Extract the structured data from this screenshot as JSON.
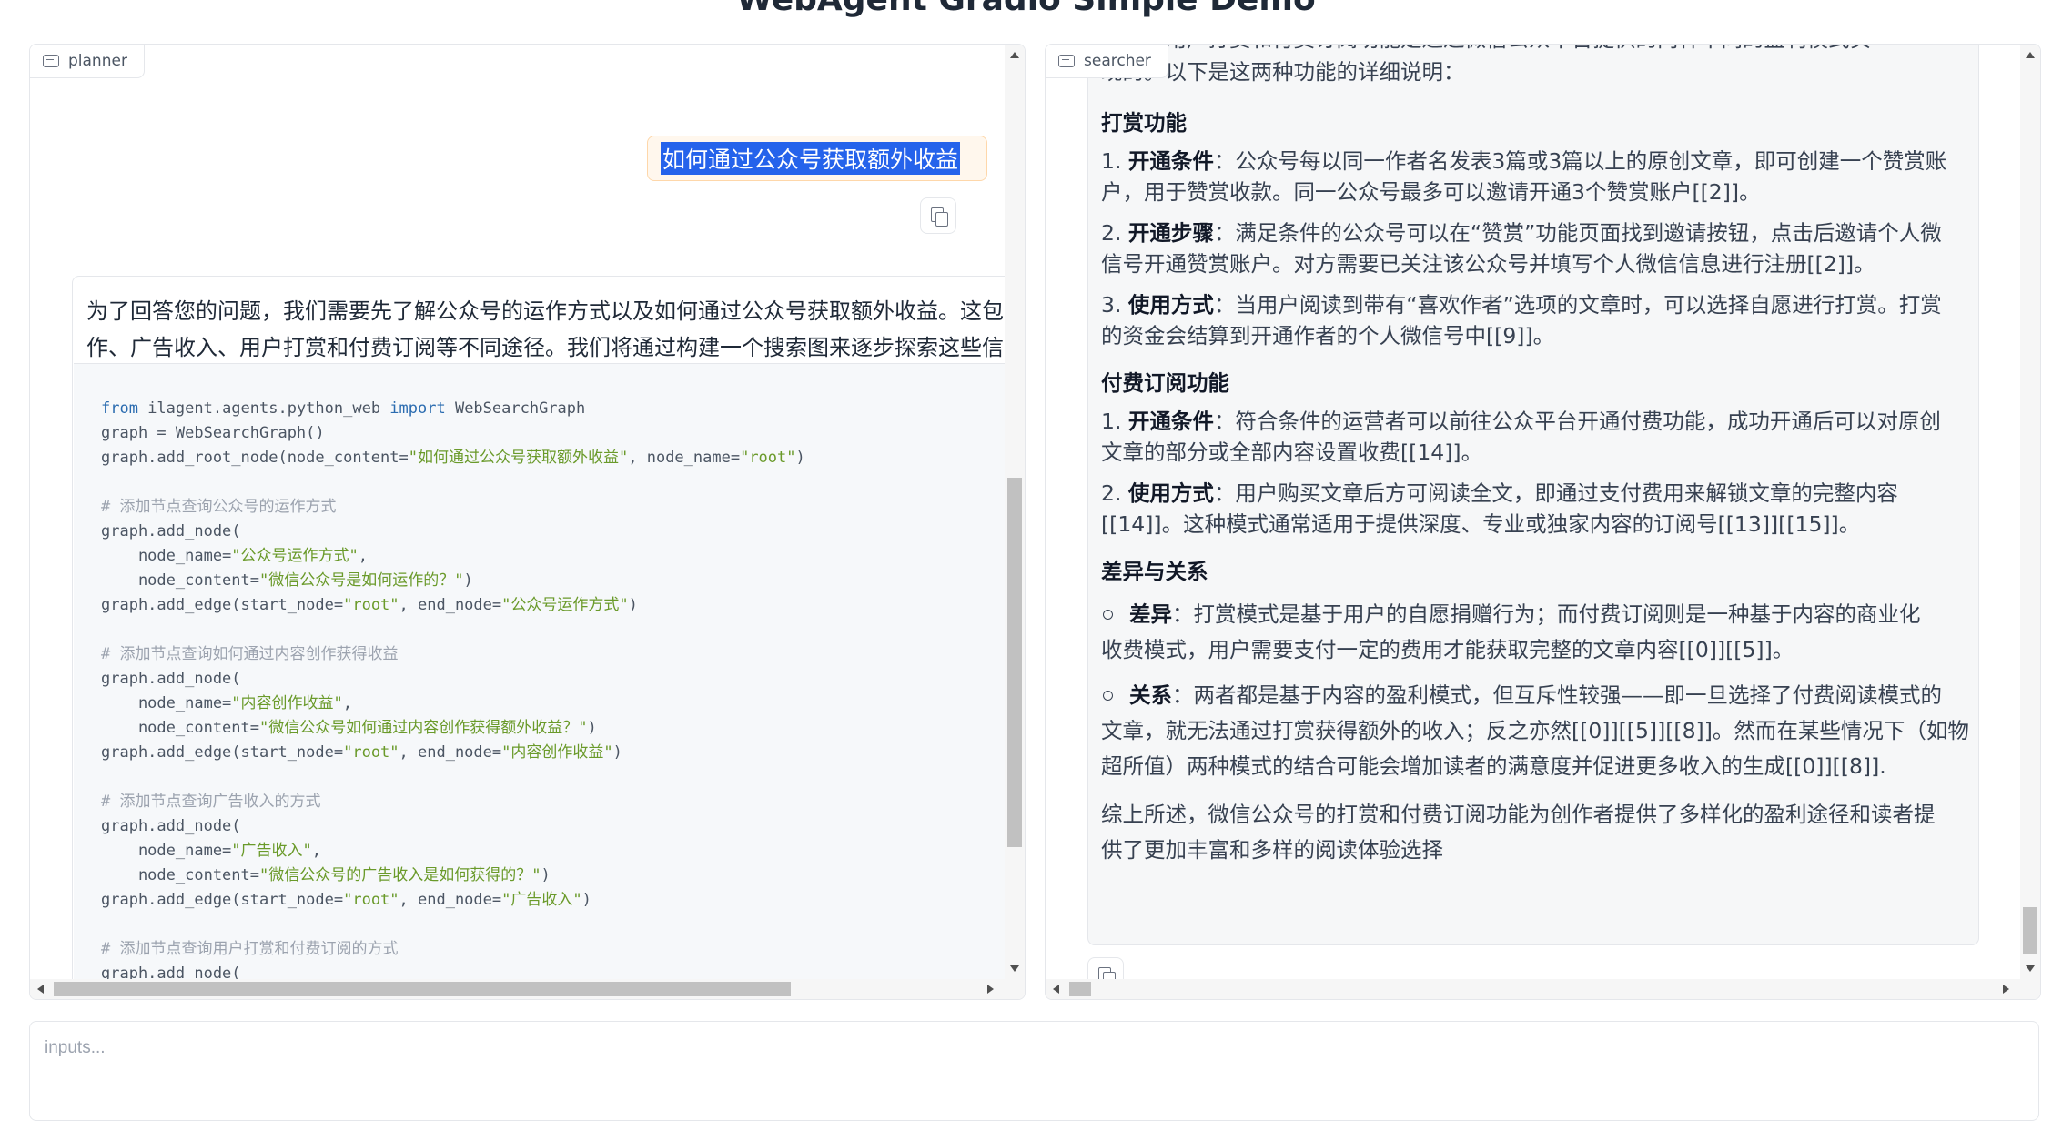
{
  "page": {
    "title": "WebAgent Gradio Simple Demo"
  },
  "planner": {
    "label": "planner",
    "user_message": "如何通过公众号获取额外收益",
    "bot_text_line1": "为了回答您的问题，我们需要先了解公众号的运作方式以及如何通过公众号获取额外收益。这包",
    "bot_text_line2": "作、广告收入、用户打赏和付费订阅等不同途径。我们将通过构建一个搜索图来逐步探索这些信",
    "code": {
      "l1_kw1": "from",
      "l1_mod": " ilagent.agents.python_web ",
      "l1_kw2": "import",
      "l1_name": " WebSearchGraph",
      "l2": "graph = WebSearchGraph()",
      "l3_a": "graph.add_root_node(node_content=",
      "l3_s1": "\"如何通过公众号获取额外收益\"",
      "l3_b": ", node_name=",
      "l3_s2": "\"root\"",
      "l3_c": ")",
      "c1": "# 添加节点查询公众号的运作方式",
      "l4": "graph.add_node(",
      "l5_a": "    node_name=",
      "l5_s": "\"公众号运作方式\"",
      "l5_b": ",",
      "l6_a": "    node_content=",
      "l6_s": "\"微信公众号是如何运作的？\"",
      "l6_b": ")",
      "l7_a": "graph.add_edge(start_node=",
      "l7_s1": "\"root\"",
      "l7_b": ", end_node=",
      "l7_s2": "\"公众号运作方式\"",
      "l7_c": ")",
      "c2": "# 添加节点查询如何通过内容创作获得收益",
      "l8": "graph.add_node(",
      "l9_a": "    node_name=",
      "l9_s": "\"内容创作收益\"",
      "l9_b": ",",
      "l10_a": "    node_content=",
      "l10_s": "\"微信公众号如何通过内容创作获得额外收益？\"",
      "l10_b": ")",
      "l11_a": "graph.add_edge(start_node=",
      "l11_s1": "\"root\"",
      "l11_b": ", end_node=",
      "l11_s2": "\"内容创作收益\"",
      "l11_c": ")",
      "c3": "# 添加节点查询广告收入的方式",
      "l12": "graph.add_node(",
      "l13_a": "    node_name=",
      "l13_s": "\"广告收入\"",
      "l13_b": ",",
      "l14_a": "    node_content=",
      "l14_s": "\"微信公众号的广告收入是如何获得的？\"",
      "l14_b": ")",
      "l15_a": "graph.add_edge(start_node=",
      "l15_s1": "\"root\"",
      "l15_b": ", end_node=",
      "l15_s2": "\"广告收入\"",
      "l15_c": ")",
      "c4": "# 添加节点查询用户打赏和付费订阅的方式",
      "l16": "graph.add_node("
    }
  },
  "searcher": {
    "label": "searcher",
    "intro_cut": "众号的用户打赏和付费订阅功能是通过微信公众平台提供的两种不同的盈利模式实",
    "intro_end": "现的。以下是这两种功能的详细说明：",
    "reward": {
      "heading": "打赏功能",
      "i1_num": "1. ",
      "i1_term": "开通条件",
      "i1_a": "：公众号每以同一作者名发表3篇或3篇以上的原创文章，即可创建一个赞赏账",
      "i1_b": "户，用于赞赏收款。同一公众号最多可以邀请开通3个赞赏账户[[2]]。",
      "i2_num": "2. ",
      "i2_term": "开通步骤",
      "i2_a": "：满足条件的公众号可以在“赞赏”功能页面找到邀请按钮，点击后邀请个人微",
      "i2_b": "信号开通赞赏账户。对方需要已关注该公众号并填写个人微信信息进行注册[[2]]。",
      "i3_num": "3. ",
      "i3_term": "使用方式",
      "i3_a": "：当用户阅读到带有“喜欢作者”选项的文章时，可以选择自愿进行打赏。打赏",
      "i3_b": "的资金会结算到开通作者的个人微信号中[[9]]。"
    },
    "paid": {
      "heading": "付费订阅功能",
      "i1_num": "1. ",
      "i1_term": "开通条件",
      "i1_a": "：符合条件的运营者可以前往公众平台开通付费功能，成功开通后可以对原创",
      "i1_b": "文章的部分或全部内容设置收费[[14]]。",
      "i2_num": "2. ",
      "i2_term": "使用方式",
      "i2_a": "：用户购买文章后方可阅读全文，即通过支付费用来解锁文章的完整内容",
      "i2_b": "[[14]]。这种模式通常适用于提供深度、专业或独家内容的订阅号[[13]][[15]]。"
    },
    "diff": {
      "heading": "差异与关系",
      "b1_term": "差异",
      "b1_a": "：打赏模式是基于用户的自愿捐赠行为；而付费订阅则是一种基于内容的商业化",
      "b1_b": "收费模式，用户需要支付一定的费用才能获取完整的文章内容[[0]][[5]]。",
      "b2_term": "关系",
      "b2_a": "：两者都是基于内容的盈利模式，但互斥性较强——即一旦选择了付费阅读模式的",
      "b2_b": "文章，就无法通过打赏获得额外的收入；反之亦然[[0]][[5]][[8]]。然而在某些情况下（如物",
      "b2_c": "超所值）两种模式的结合可能会增加读者的满意度并促进更多收入的生成[[0]][[8]]."
    },
    "summary_a": "综上所述，微信公众号的打赏和付费订阅功能为创作者提供了多样化的盈利途径和读者提",
    "summary_b": "供了更加丰富和多样的阅读体验选择"
  },
  "input": {
    "placeholder": "inputs..."
  }
}
